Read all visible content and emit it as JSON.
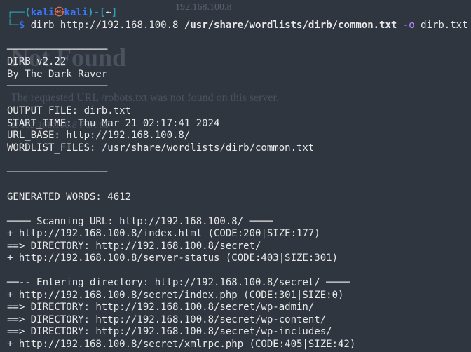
{
  "browser_bg": {
    "url": "192.168.100.8",
    "title": "Not Found",
    "message": "The requested URL /robots.txt was not found on this server.",
    "server_line": "at 192.168.100.8 Port 80"
  },
  "prompt": {
    "open_paren": "(",
    "user": "kali",
    "at": "㉿",
    "host": "kali",
    "close_paren": ")",
    "dash_open": "-[",
    "cwd": "~",
    "close_br": "]",
    "corner1": "┌──",
    "corner2": "└─",
    "dollar": "$",
    "command": "dirb",
    "arg_url": "http://192.168.100.8",
    "arg_wordlist": "/usr/share/wordlists/dirb/common.txt",
    "flag_o": "-o",
    "arg_outfile": "dirb.txt"
  },
  "dirb": {
    "hr": "─────────────────",
    "version": "DIRB v2.22",
    "byline": "By The Dark Raver",
    "dividerlong": "─────────────────",
    "output_file": "OUTPUT_FILE: dirb.txt",
    "start_time": "START_TIME: Thu Mar 21 02:17:41 2024",
    "url_base": "URL_BASE: http://192.168.100.8/",
    "wordlist": "WORDLIST_FILES: /usr/share/wordlists/dirb/common.txt",
    "generated_words": "GENERATED WORDS: 4612",
    "scan_urls_label": "──── Scanning URL: http://192.168.100.8/ ────",
    "hit1": "+ http://192.168.100.8/index.html (CODE:200|SIZE:177)",
    "dir1": "==> DIRECTORY: http://192.168.100.8/secret/",
    "hit2": "+ http://192.168.100.8/server-status (CODE:403|SIZE:301)",
    "enter_dir": "──-- Entering directory: http://192.168.100.8/secret/ ────",
    "hit3": "+ http://192.168.100.8/secret/index.php (CODE:301|SIZE:0)",
    "dir2": "==> DIRECTORY: http://192.168.100.8/secret/wp-admin/",
    "dir3": "==> DIRECTORY: http://192.168.100.8/secret/wp-content/",
    "dir4": "==> DIRECTORY: http://192.168.100.8/secret/wp-includes/",
    "hit4": "+ http://192.168.100.8/secret/xmlrpc.php (CODE:405|SIZE:42)"
  }
}
